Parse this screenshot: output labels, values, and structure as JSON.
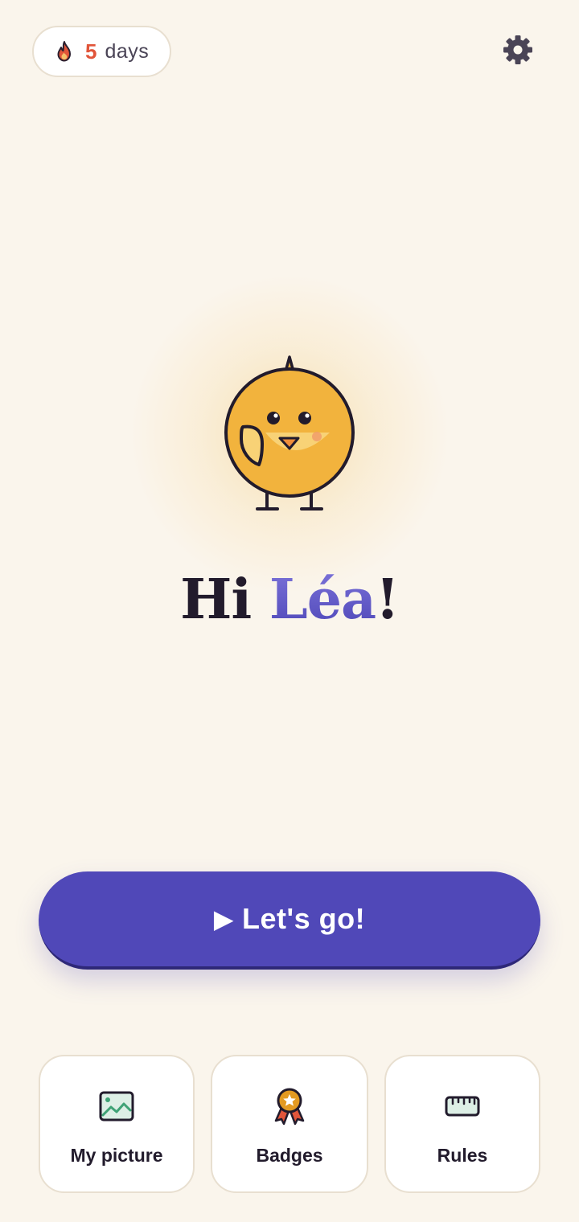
{
  "streak": {
    "count": "5",
    "unit": "days",
    "icon": "flame-icon"
  },
  "header": {
    "settings_icon": "gear-icon"
  },
  "greeting": {
    "prefix": "Hi ",
    "name": "Léa",
    "suffix": "!"
  },
  "cta": {
    "play_symbol": "▶",
    "label": "Let's go!"
  },
  "tiles": [
    {
      "label": "My picture",
      "icon": "picture-icon"
    },
    {
      "label": "Badges",
      "icon": "badge-icon"
    },
    {
      "label": "Rules",
      "icon": "ruler-icon"
    }
  ],
  "colors": {
    "background": "#FAF5EC",
    "accent": "#5048B8",
    "streak": "#E1553A",
    "mascot": "#F2B33D"
  }
}
